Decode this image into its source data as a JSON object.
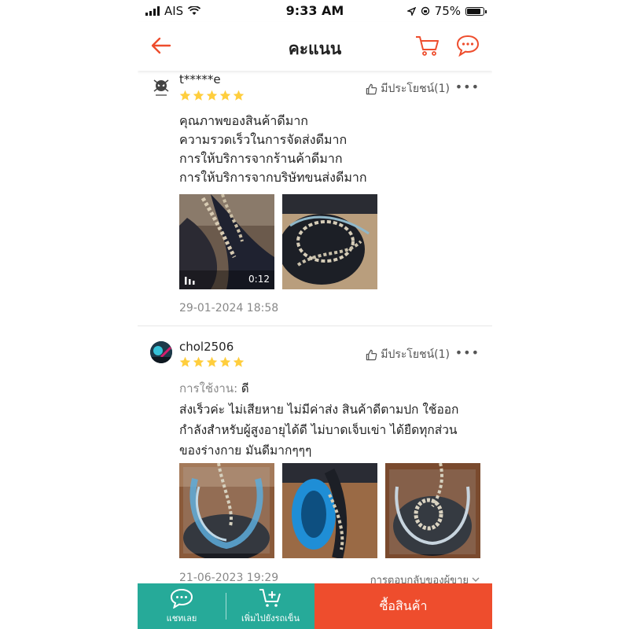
{
  "status_bar": {
    "carrier": "AIS",
    "time": "9:33 AM",
    "battery": "75%"
  },
  "header": {
    "title": "คะแนน",
    "back_icon": "arrow-left-icon",
    "cart_icon": "cart-icon",
    "chat_icon": "chat-icon",
    "accent": "#ee4d2d"
  },
  "reviews": [
    {
      "user": "t*****e",
      "rating": 5,
      "helpful": "มีประโยชน์(1)",
      "lines": [
        "คุณภาพของสินค้าดีมาก",
        "ความรวดเร็วในการจัดส่งดีมาก",
        "การให้บริการจากร้านค้าดีมาก",
        "การให้บริการจากบริษัทขนส่งดีมาก"
      ],
      "video_duration": "0:12",
      "date": "29-01-2024 18:58"
    },
    {
      "user": "chol2506",
      "rating": 5,
      "helpful": "มีประโยชน์(1)",
      "usage_label": "การใช้งาน:",
      "usage_value": "ดี",
      "lines": [
        "ส่งเร็วค่ะ ไม่เสียหาย ไม่มีค่าส่ง สินค้าดีตามปก ใช้ออก",
        "กำลังสำหรับผู้สูงอายุได้ดี ไม่บาดเจ็บเข่า ได้ยืดทุกส่วน",
        "ของร่างกาย มันดีมากๆๆๆ"
      ],
      "date": "21-06-2023 19:29",
      "seller_reply": "การตอบกลับของผู้ขาย"
    }
  ],
  "bottom_bar": {
    "chat_label": "แชทเลย",
    "add_cart_label": "เพิ่มไปยังรถเข็น",
    "buy_label": "ซื้อสินค้า",
    "green": "#26aa99",
    "orange": "#ee4d2d"
  }
}
